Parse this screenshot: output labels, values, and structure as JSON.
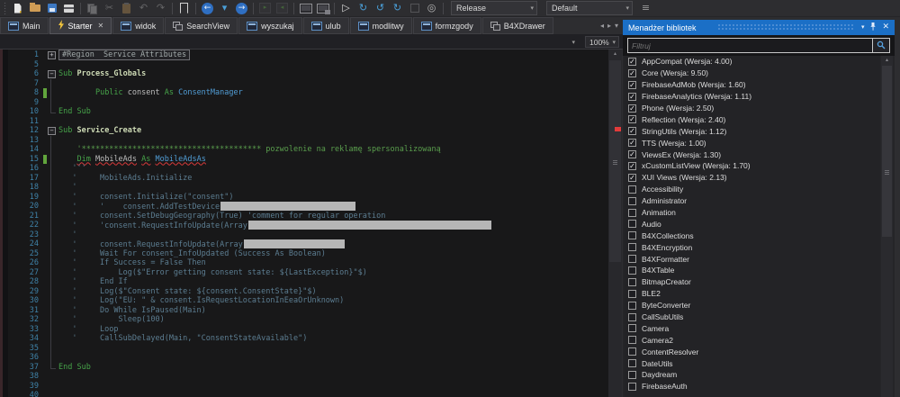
{
  "colors": {
    "panel_title_blue": "#1b6fc6",
    "keyword_green": "#46a349",
    "comment_green": "#5a9e4d",
    "comment_gray_blue": "#5c7d91",
    "type_blue": "#519dd5",
    "sub_name": "#ccd9b4",
    "line_number_blue": "#3f82a8",
    "change_bar_green": "#61a53c",
    "error_red": "#e23b3b",
    "redaction_gray": "#b6b6b6",
    "editor_bg": "#181819",
    "toolbar_bg": "#2d2d30"
  },
  "toolbar": {
    "items": [
      {
        "name": "new-button",
        "shape": "new"
      },
      {
        "name": "open-button",
        "shape": "open"
      },
      {
        "name": "save-button",
        "shape": "save"
      },
      {
        "name": "export-zip-button",
        "shape": "zip"
      },
      {
        "kind": "sep"
      },
      {
        "name": "copy-button",
        "shape": "copy",
        "disabled": true
      },
      {
        "name": "cut-button",
        "glyph": "✂",
        "color": "#b0b0b0",
        "disabled": true
      },
      {
        "name": "paste-button",
        "shape": "paste",
        "disabled": true
      },
      {
        "name": "undo-button",
        "glyph": "↶",
        "color": "#b0b0b0",
        "disabled": true
      },
      {
        "name": "redo-button",
        "glyph": "↷",
        "color": "#b0b0b0",
        "disabled": true
      },
      {
        "kind": "sep"
      },
      {
        "name": "bookmark-button",
        "shape": "bookmark"
      },
      {
        "kind": "sep"
      },
      {
        "name": "navigate-back-button",
        "shape": "back",
        "glyph_inside": "←"
      },
      {
        "name": "navigate-back-caret",
        "glyph": "▾",
        "color": "#4a9fd8"
      },
      {
        "name": "navigate-forward-button",
        "shape": "forward",
        "glyph_inside": "→"
      },
      {
        "kind": "sep"
      },
      {
        "name": "comment-button",
        "shape": "comment",
        "glyph_inside": "▸",
        "disabled": true
      },
      {
        "name": "uncomment-button",
        "shape": "uncomment",
        "glyph_inside": "◂",
        "disabled": true
      },
      {
        "kind": "sep"
      },
      {
        "name": "designer-button",
        "shape": "monitor"
      },
      {
        "name": "bridge-button",
        "shape": "monitor2"
      },
      {
        "kind": "sep"
      },
      {
        "name": "run-button",
        "glyph": "▷",
        "color": "#d8d8d8"
      },
      {
        "name": "compile-run-button",
        "glyph": "↻",
        "color": "#4a9fd8"
      },
      {
        "name": "rapid-debug-button",
        "glyph": "↺",
        "color": "#4a9fd8"
      },
      {
        "name": "resume-button",
        "glyph": "↻",
        "color": "#4a9fd8"
      },
      {
        "name": "stop-button",
        "shape": "stop",
        "disabled": true
      },
      {
        "name": "clean-project-button",
        "glyph": "◎",
        "color": "#b8b8b8"
      },
      {
        "kind": "sep"
      },
      {
        "name": "build-configuration-combo",
        "kind": "combo",
        "label": "Release"
      },
      {
        "name": "conditional-symbols-combo",
        "kind": "combo",
        "label": "Default"
      },
      {
        "name": "toolbar-overflow",
        "glyph": "≡",
        "color": "#9a9a9a"
      }
    ]
  },
  "tabs": {
    "close_glyph": "✕",
    "items": [
      {
        "label": "Main",
        "icon": "form"
      },
      {
        "label": "Starter",
        "icon": "service",
        "active": true,
        "closable": true
      },
      {
        "label": "widok",
        "icon": "form"
      },
      {
        "label": "SearchView",
        "icon": "class"
      },
      {
        "label": "wyszukaj",
        "icon": "form"
      },
      {
        "label": "ulub",
        "icon": "form"
      },
      {
        "label": "modlitwy",
        "icon": "form"
      },
      {
        "label": "formzgody",
        "icon": "form"
      },
      {
        "label": "B4XDrawer",
        "icon": "class"
      }
    ],
    "controls": {
      "scroll_left": "◂",
      "scroll_right": "▸",
      "menu": "▾"
    }
  },
  "editor": {
    "zoom": "100%",
    "member_combo_caret": "▾",
    "zoom_caret": "▾",
    "scroll_up_glyph": "▴",
    "lines": [
      {
        "n": "1",
        "fold": "+",
        "seg": [
          {
            "t": "#Region  Service Attributes",
            "c": "reg"
          }
        ]
      },
      {
        "n": "5"
      },
      {
        "n": "6",
        "fold": "-",
        "seg": [
          {
            "t": "Sub ",
            "c": "kw"
          },
          {
            "t": "Process_Globals",
            "c": "sub"
          }
        ]
      },
      {
        "n": "7",
        "guide": true
      },
      {
        "n": "8",
        "guide": true,
        "change": true,
        "seg": [
          {
            "t": "        "
          },
          {
            "t": "Public ",
            "c": "kw"
          },
          {
            "t": "consent ",
            "c": "id"
          },
          {
            "t": "As ",
            "c": "kw"
          },
          {
            "t": "ConsentManager",
            "c": "ty"
          }
        ]
      },
      {
        "n": "9",
        "guide": true
      },
      {
        "n": "10",
        "corner": true,
        "seg": [
          {
            "t": "End Sub",
            "c": "kw"
          }
        ]
      },
      {
        "n": "11"
      },
      {
        "n": "12",
        "fold": "-",
        "seg": [
          {
            "t": "Sub ",
            "c": "kw"
          },
          {
            "t": "Service_Create",
            "c": "sub"
          }
        ]
      },
      {
        "n": "13",
        "guide": true
      },
      {
        "n": "14",
        "guide": true,
        "seg": [
          {
            "t": "    "
          },
          {
            "t": "'*************************************** pozwolenie na reklamę spersonalizowaną",
            "c": "cm"
          }
        ]
      },
      {
        "n": "15",
        "guide": true,
        "change": true,
        "seg": [
          {
            "t": "    "
          },
          {
            "t": "Dim",
            "c": "kw",
            "e": true
          },
          {
            "t": " "
          },
          {
            "t": "MobileAds",
            "c": "id",
            "e": true
          },
          {
            "t": " "
          },
          {
            "t": "As",
            "c": "kw",
            "e": true
          },
          {
            "t": " "
          },
          {
            "t": "MobileAdsAs",
            "c": "ty",
            "e": true
          }
        ]
      },
      {
        "n": "16",
        "guide": true,
        "seg": [
          {
            "t": "   '''",
            "c": "cb"
          }
        ]
      },
      {
        "n": "17",
        "guide": true,
        "seg": [
          {
            "t": "   '     MobileAds.Initialize",
            "c": "cb"
          }
        ]
      },
      {
        "n": "18",
        "guide": true,
        "seg": [
          {
            "t": "   '",
            "c": "cb"
          }
        ]
      },
      {
        "n": "19",
        "guide": true,
        "seg": [
          {
            "t": "   '     consent.Initialize(\"consent\")",
            "c": "cb"
          }
        ]
      },
      {
        "n": "20",
        "guide": true,
        "redact": 150,
        "seg": [
          {
            "t": "   '     '    consent.AddTestDevice",
            "c": "cb"
          }
        ]
      },
      {
        "n": "21",
        "guide": true,
        "seg": [
          {
            "t": "   '     consent.SetDebugGeography(True) 'comment for regular operation",
            "c": "cb"
          }
        ]
      },
      {
        "n": "22",
        "guide": true,
        "redact": 270,
        "seg": [
          {
            "t": "   '     'consent.RequestInfoUpdate(Array",
            "c": "cb"
          }
        ]
      },
      {
        "n": "23",
        "guide": true,
        "seg": [
          {
            "t": "   '",
            "c": "cb"
          }
        ]
      },
      {
        "n": "24",
        "guide": true,
        "redact": 112,
        "seg": [
          {
            "t": "   '     consent.RequestInfoUpdate(Array",
            "c": "cb"
          }
        ]
      },
      {
        "n": "25",
        "guide": true,
        "seg": [
          {
            "t": "   '     Wait For consent_InfoUpdated (Success As Boolean)",
            "c": "cb"
          }
        ]
      },
      {
        "n": "26",
        "guide": true,
        "seg": [
          {
            "t": "   '     If Success = False Then",
            "c": "cb"
          }
        ]
      },
      {
        "n": "27",
        "guide": true,
        "seg": [
          {
            "t": "   '         Log($\"Error getting consent state: ${LastException}\"$)",
            "c": "cb"
          }
        ]
      },
      {
        "n": "28",
        "guide": true,
        "seg": [
          {
            "t": "   '     End If",
            "c": "cb"
          }
        ]
      },
      {
        "n": "29",
        "guide": true,
        "seg": [
          {
            "t": "   '     Log($\"Consent state: ${consent.ConsentState}\"$)",
            "c": "cb"
          }
        ]
      },
      {
        "n": "30",
        "guide": true,
        "seg": [
          {
            "t": "   '     Log(\"EU: \" & consent.IsRequestLocationInEeaOrUnknown)",
            "c": "cb"
          }
        ]
      },
      {
        "n": "31",
        "guide": true,
        "seg": [
          {
            "t": "   '     Do While IsPaused(Main)",
            "c": "cb"
          }
        ]
      },
      {
        "n": "32",
        "guide": true,
        "seg": [
          {
            "t": "   '         Sleep(100)",
            "c": "cb"
          }
        ]
      },
      {
        "n": "33",
        "guide": true,
        "seg": [
          {
            "t": "   '     Loop",
            "c": "cb"
          }
        ]
      },
      {
        "n": "34",
        "guide": true,
        "seg": [
          {
            "t": "   '     CallSubDelayed(Main, \"ConsentStateAvailable\")",
            "c": "cb"
          }
        ]
      },
      {
        "n": "35",
        "guide": true
      },
      {
        "n": "36",
        "guide": true
      },
      {
        "n": "37",
        "corner": true,
        "seg": [
          {
            "t": "End Sub",
            "c": "kw"
          }
        ]
      },
      {
        "n": "38"
      },
      {
        "n": "39"
      },
      {
        "n": "40"
      }
    ]
  },
  "library_panel": {
    "title": "Menadżer bibliotek",
    "menu_glyph": "▾",
    "close_glyph": "✕",
    "filter_placeholder": "Filtruj",
    "check_glyph": "✓",
    "scroll_up_glyph": "▴",
    "items": [
      {
        "label": "AppCompat (Wersja: 4.00)",
        "checked": true
      },
      {
        "label": "Core (Wersja: 9.50)",
        "checked": true
      },
      {
        "label": "FirebaseAdMob (Wersja: 1.60)",
        "checked": true
      },
      {
        "label": "FirebaseAnalytics (Wersja: 1.11)",
        "checked": true
      },
      {
        "label": "Phone (Wersja: 2.50)",
        "checked": true
      },
      {
        "label": "Reflection (Wersja: 2.40)",
        "checked": true
      },
      {
        "label": "StringUtils (Wersja: 1.12)",
        "checked": true
      },
      {
        "label": "TTS (Wersja: 1.00)",
        "checked": true
      },
      {
        "label": "ViewsEx (Wersja: 1.30)",
        "checked": true
      },
      {
        "label": "xCustomListView (Wersja: 1.70)",
        "checked": true
      },
      {
        "label": "XUI Views (Wersja: 2.13)",
        "checked": true
      },
      {
        "label": "Accessibility",
        "checked": false
      },
      {
        "label": "Administrator",
        "checked": false
      },
      {
        "label": "Animation",
        "checked": false
      },
      {
        "label": "Audio",
        "checked": false
      },
      {
        "label": "B4XCollections",
        "checked": false
      },
      {
        "label": "B4XEncryption",
        "checked": false
      },
      {
        "label": "B4XFormatter",
        "checked": false
      },
      {
        "label": "B4XTable",
        "checked": false
      },
      {
        "label": "BitmapCreator",
        "checked": false
      },
      {
        "label": "BLE2",
        "checked": false
      },
      {
        "label": "ByteConverter",
        "checked": false
      },
      {
        "label": "CallSubUtils",
        "checked": false
      },
      {
        "label": "Camera",
        "checked": false
      },
      {
        "label": "Camera2",
        "checked": false
      },
      {
        "label": "ContentResolver",
        "checked": false
      },
      {
        "label": "DateUtils",
        "checked": false
      },
      {
        "label": "Daydream",
        "checked": false
      },
      {
        "label": "FirebaseAuth",
        "checked": false
      }
    ]
  }
}
